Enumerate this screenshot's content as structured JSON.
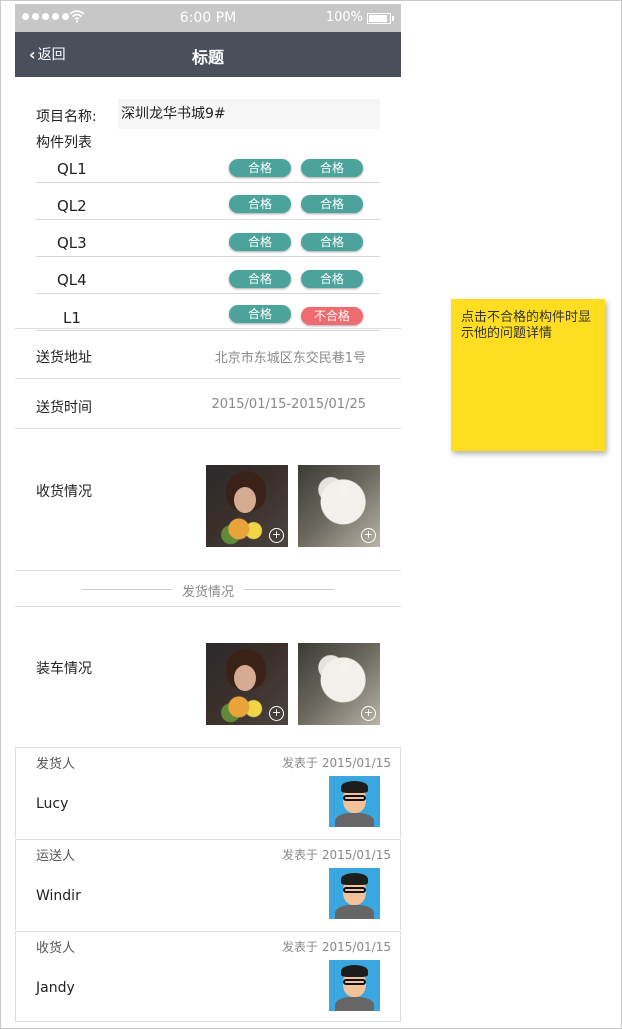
{
  "status_bar": {
    "time": "6:00 PM",
    "battery": "100%"
  },
  "nav": {
    "back_label": "返回",
    "title": "标题"
  },
  "project": {
    "label": "项目名称:",
    "value": "深圳龙华书城9#"
  },
  "components": {
    "header": "构件列表",
    "rows": [
      {
        "name": "QL1",
        "status1": "合格",
        "status2": "合格"
      },
      {
        "name": "QL2",
        "status1": "合格",
        "status2": "合格"
      },
      {
        "name": "QL3",
        "status1": "合格",
        "status2": "合格"
      },
      {
        "name": "QL4",
        "status1": "合格",
        "status2": "合格"
      },
      {
        "name": "L1",
        "status1": "合格",
        "status2": "不合格"
      }
    ]
  },
  "delivery": {
    "address_label": "送货地址",
    "address": "北京市东城区东交民巷1号",
    "time_label": "送货时间",
    "time": "2015/01/15-2015/01/25"
  },
  "receipt": {
    "label": "收货情况"
  },
  "divider": {
    "label": "发货情况"
  },
  "loading": {
    "label": "装车情况"
  },
  "people": [
    {
      "role": "发货人",
      "date": "发表于 2015/01/15",
      "name": "Lucy"
    },
    {
      "role": "运送人",
      "date": "发表于 2015/01/15",
      "name": "Windir"
    },
    {
      "role": "收货人",
      "date": "发表于 2015/01/15",
      "name": "Jandy"
    }
  ],
  "sticky_note": {
    "text": "点击不合格的构件时显示他的问题详情"
  },
  "colors": {
    "nav_bg": "#4a4f5c",
    "pass": "#4ba39b",
    "fail": "#f06b70",
    "note": "#ffde22",
    "avatar_bg": "#3aa7e0"
  }
}
